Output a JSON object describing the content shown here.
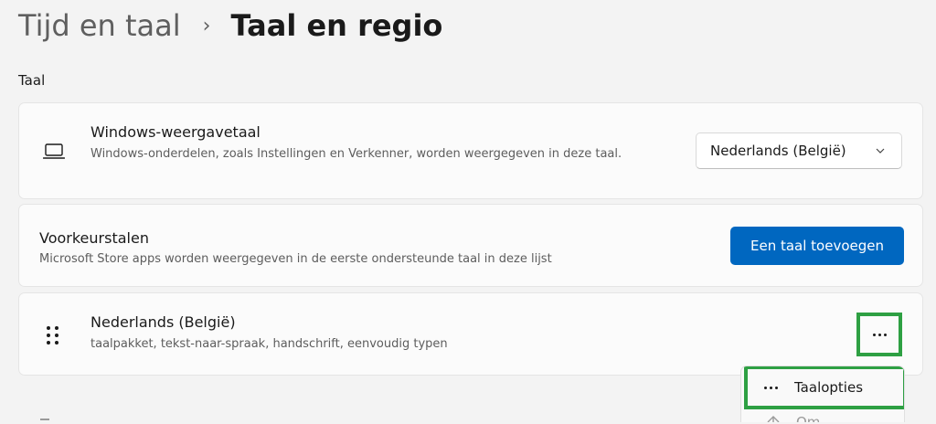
{
  "breadcrumb": {
    "parent": "Tijd en taal",
    "separator": "›",
    "current": "Taal en regio"
  },
  "section": {
    "label": "Taal"
  },
  "display_language": {
    "icon": "laptop-icon",
    "title": "Windows-weergavetaal",
    "description": "Windows-onderdelen, zoals Instellingen en Verkenner, worden weergegeven in deze taal.",
    "selected": "Nederlands (België)"
  },
  "preferred_languages": {
    "title": "Voorkeurstalen",
    "description": "Microsoft Store apps worden weergegeven in de eerste ondersteunde taal in deze lijst",
    "add_button": "Een taal toevoegen"
  },
  "language_item": {
    "icon": "drag-handle-icon",
    "title": "Nederlands (België)",
    "description": "taalpakket, tekst-naar-spraak, handschrift, eenvoudig typen"
  },
  "context_menu": {
    "items": [
      {
        "icon": "more-icon",
        "label": "Taalopties"
      },
      {
        "icon": "arrow-up-icon",
        "label": "Om..."
      }
    ]
  },
  "colors": {
    "accent": "#0067c0",
    "highlight": "#2ea043",
    "background": "#f3f3f3",
    "card": "#fbfbfb"
  }
}
